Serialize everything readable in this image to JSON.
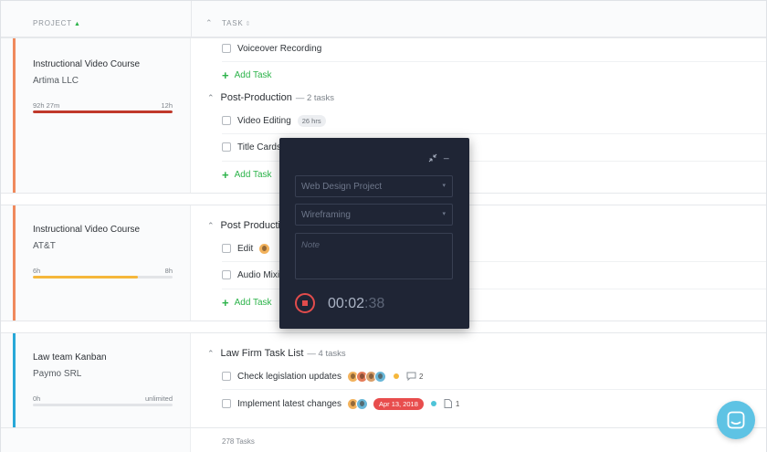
{
  "header": {
    "project_col": "PROJECT",
    "task_col": "TASK"
  },
  "projects": [
    {
      "name": "Instructional Video Course",
      "client": "Artima LLC",
      "logged": "92h 27m",
      "budget": "12h",
      "progress": 1.0,
      "accent": "#f08a5d",
      "bar_color": "#c0392b"
    },
    {
      "name": "Instructional Video Course",
      "client": "AT&T",
      "logged": "6h",
      "budget": "8h",
      "progress": 0.75,
      "accent": "#f08a5d",
      "bar_color": "#f5b73b"
    },
    {
      "name": "Law team Kanban",
      "client": "Paymo SRL",
      "logged": "0h",
      "budget": "unlimited",
      "progress": 0.0,
      "accent": "#28a8d8",
      "bar_color": "#28a8d8"
    }
  ],
  "tasks": {
    "voiceover": "Voiceover Recording",
    "add_task": "Add Task",
    "post_production": {
      "name": "Post-Production",
      "count": "— 2 tasks"
    },
    "video_editing": {
      "name": "Video Editing",
      "badge": "26 hrs"
    },
    "title_cards": "Title Cards",
    "post_production_2": {
      "name": "Post Productio",
      "count": ""
    },
    "edit": "Edit",
    "audio_mix": "Audio Mixi",
    "law_list": {
      "name": "Law Firm Task List",
      "count": "— 4 tasks"
    },
    "check_legislation": {
      "name": "Check legislation updates",
      "comments": "2"
    },
    "implement_changes": {
      "name": "Implement latest changes",
      "date": "Apr 13, 2018",
      "files": "1"
    }
  },
  "footer": {
    "count": "278 Tasks"
  },
  "timer": {
    "project": "Web Design Project",
    "task": "Wireframing",
    "note_placeholder": "Note",
    "elapsed_main": "00:02",
    "elapsed_seconds": ":38"
  },
  "colors": {
    "green": "#2cb34a",
    "timer_bg": "#1f2535",
    "stop_red": "#e24c4c",
    "chat": "#5ec3e4"
  },
  "icons": [
    "sort-up-icon",
    "sort-icon",
    "chevron-up-icon",
    "checkbox-icon",
    "plus-icon",
    "comment-icon",
    "file-icon",
    "collapse-icon",
    "minimize-icon",
    "chevron-down-icon",
    "stop-icon",
    "chat-icon"
  ]
}
